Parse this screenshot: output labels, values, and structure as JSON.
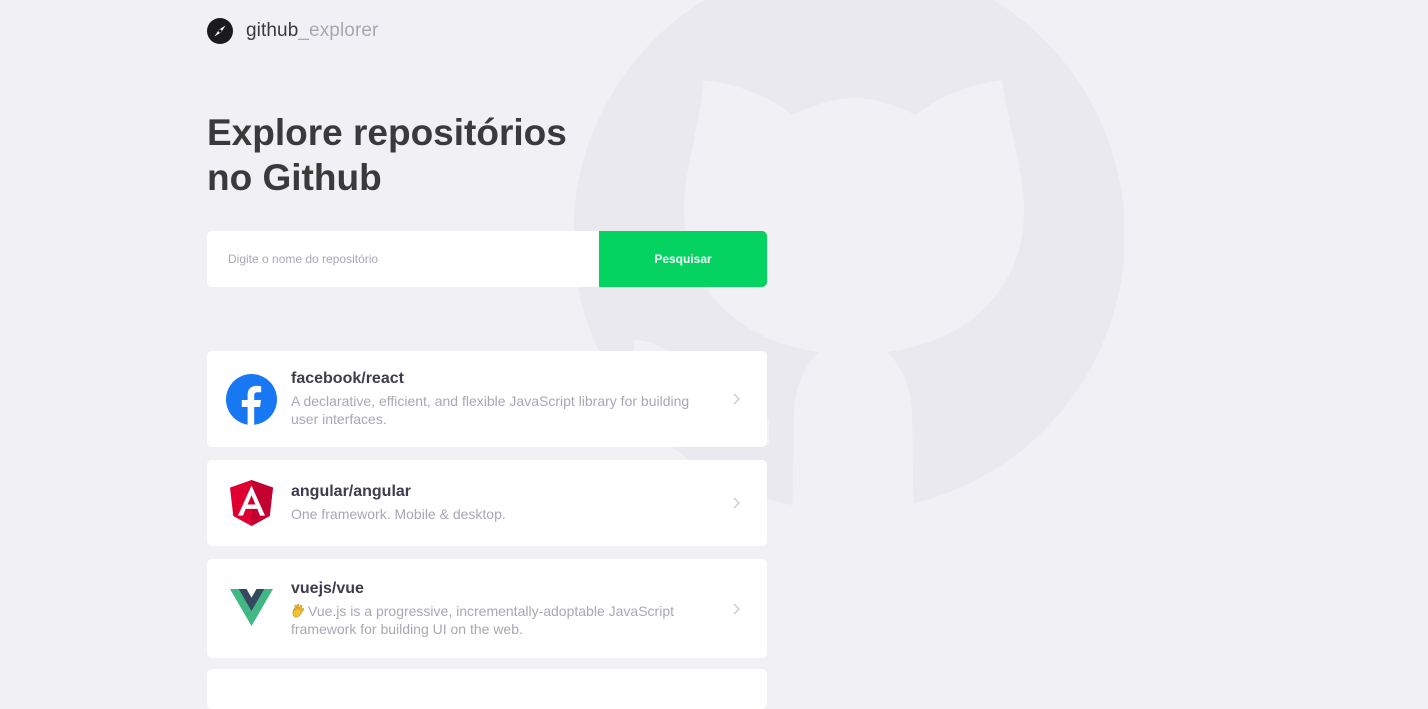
{
  "brand": {
    "name_bold": "github",
    "name_light": "_explorer",
    "icon": "compass-icon"
  },
  "headline": {
    "line1": "Explore repositórios",
    "line2": "no Github"
  },
  "search": {
    "placeholder": "Digite o nome do repositório",
    "value": "",
    "button_label": "Pesquisar"
  },
  "colors": {
    "accent": "#04d361",
    "background": "#f0f0f5",
    "title": "#3a3a3a",
    "muted": "#a8a8b3"
  },
  "repositories": [
    {
      "full_name": "facebook/react",
      "description": "A declarative, efficient, and flexible JavaScript library for building user interfaces.",
      "avatar_icon": "facebook-logo-icon"
    },
    {
      "full_name": "angular/angular",
      "description": "One framework. Mobile & desktop.",
      "avatar_icon": "angular-logo-icon"
    },
    {
      "full_name": "vuejs/vue",
      "description_prefix_icon": "vulcan-salute-emoji-icon",
      "description": "Vue.js is a progressive, incrementally-adoptable JavaScript framework for building UI on the web.",
      "avatar_icon": "vue-logo-icon"
    }
  ]
}
